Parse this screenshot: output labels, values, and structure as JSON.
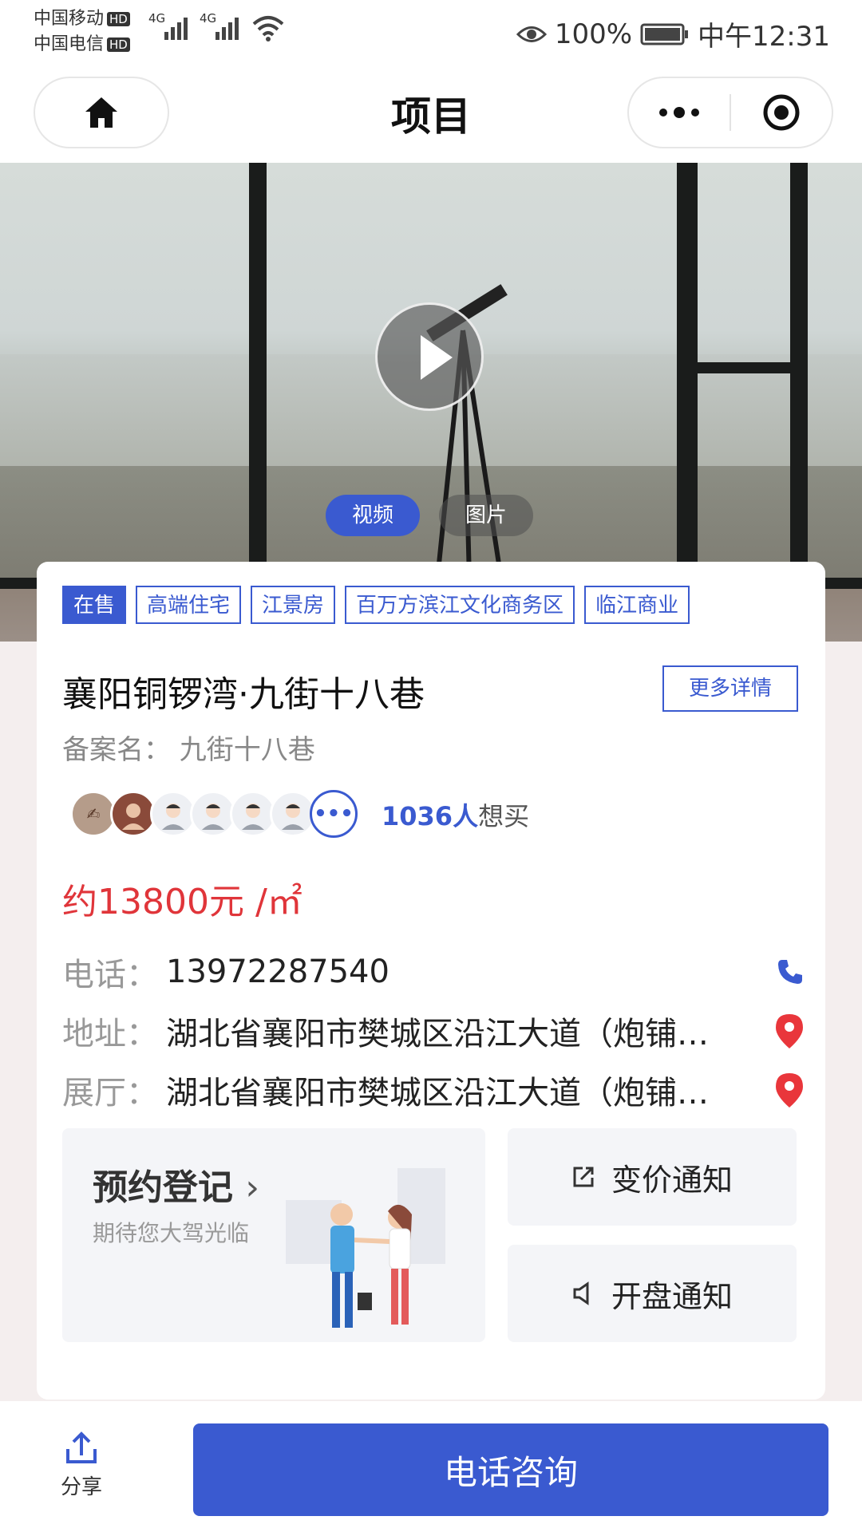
{
  "status_bar": {
    "carrier1": "中国移动",
    "carrier2": "中国电信",
    "hd": "HD",
    "net1": "4G",
    "net2": "4G",
    "battery": "100%",
    "time": "中午12:31"
  },
  "nav": {
    "title": "项目",
    "home_icon": "home-icon",
    "more_icon": "more-icon",
    "close_icon": "target-icon"
  },
  "media": {
    "tabs": [
      "视频",
      "图片"
    ],
    "active_tab": "视频"
  },
  "project": {
    "tags": [
      "在售",
      "高端住宅",
      "江景房",
      "百万方滨江文化商务区",
      "临江商业"
    ],
    "name": "襄阳铜锣湾·九街十八巷",
    "more_details": "更多详情",
    "registered_name": "备案名：  九街十八巷",
    "interested_count": "1036人",
    "interested_suffix": "想买",
    "price": "约13800元 /㎡",
    "phone_label": "电话：",
    "phone": "13972287540",
    "address_label": "地址：",
    "address": "湖北省襄阳市樊城区沿江大道（炮铺…",
    "showroom_label": "展厅：",
    "showroom": "湖北省襄阳市樊城区沿江大道（炮铺…"
  },
  "actions": {
    "reserve_title": "预约登记",
    "reserve_sub": "期待您大驾光临",
    "price_notice": "变价通知",
    "opening_notice": "开盘通知"
  },
  "bottom": {
    "share": "分享",
    "call": "电话咨询"
  },
  "colors": {
    "accent": "#3a5ad0",
    "price": "#e0353a"
  }
}
